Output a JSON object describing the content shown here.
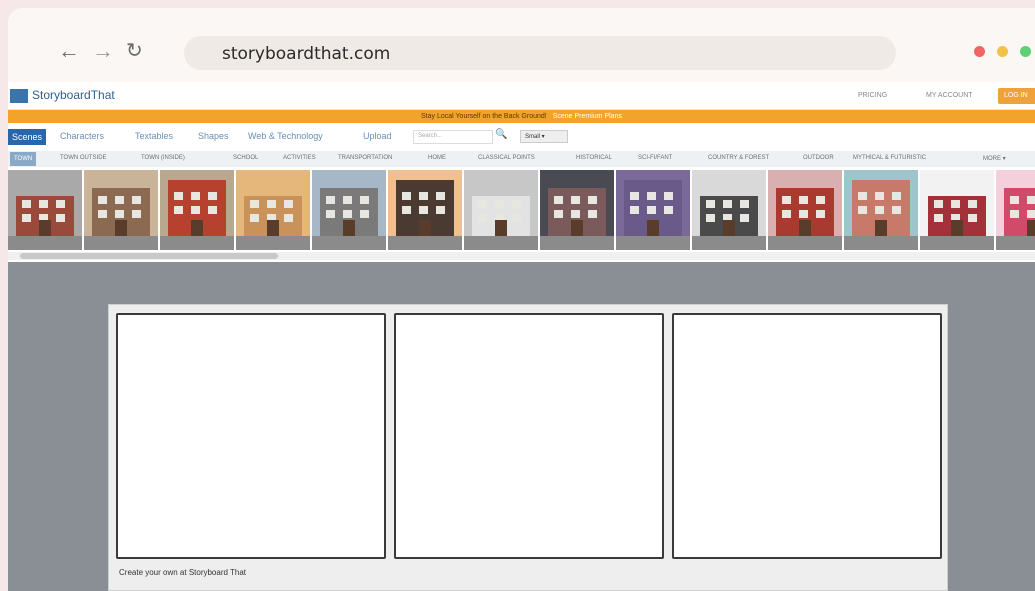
{
  "browser": {
    "url": "storyboardthat.com",
    "back_icon": "←",
    "forward_icon": "→",
    "reload_icon": "↻",
    "dots": [
      "#f06464",
      "#f0c24a",
      "#5fcf74"
    ]
  },
  "header": {
    "logo": "StoryboardThat",
    "pricing": "PRICING",
    "account": "MY ACCOUNT",
    "cta": "LOG IN"
  },
  "promo": {
    "text": "Stay Local Yourself on the Back Ground!",
    "cta": "Scene Premium Plans"
  },
  "tabs": [
    {
      "label": "Scenes",
      "active": true
    },
    {
      "label": "Characters",
      "active": false
    },
    {
      "label": "Textables",
      "active": false
    },
    {
      "label": "Shapes",
      "active": false
    },
    {
      "label": "Web & Technology",
      "active": false
    },
    {
      "label": "Upload",
      "active": false
    }
  ],
  "search": {
    "placeholder": "Search..."
  },
  "view": {
    "label": "Small ▾"
  },
  "categories": [
    {
      "label": "TOWN",
      "active": true
    },
    {
      "label": "TOWN OUTSIDE",
      "active": false
    },
    {
      "label": "TOWN (INSIDE)",
      "active": false
    },
    {
      "label": "SCHOOL",
      "active": false
    },
    {
      "label": "ACTIVITIES",
      "active": false
    },
    {
      "label": "TRANSPORTATION",
      "active": false
    },
    {
      "label": "HOME",
      "active": false
    },
    {
      "label": "CLASSICAL POINTS",
      "active": false
    },
    {
      "label": "HISTORICAL",
      "active": false
    },
    {
      "label": "SCI-FI/FANT",
      "active": false
    },
    {
      "label": "COUNTRY & FOREST",
      "active": false
    },
    {
      "label": "OUTDOOR",
      "active": false
    },
    {
      "label": "MYTHICAL & FUTURISTIC",
      "active": false
    },
    {
      "label": "MORE ▾",
      "active": false
    }
  ],
  "scenes": [
    {
      "name": "scene-1",
      "sky": "#a9a9a9",
      "bldg": "#9a4a3a"
    },
    {
      "name": "scene-2",
      "sky": "#c9b49a",
      "bldg": "#8c6a52"
    },
    {
      "name": "scene-3",
      "sky": "#b8a890",
      "bldg": "#b5412e"
    },
    {
      "name": "scene-4",
      "sky": "#e6b77a",
      "bldg": "#c9925a"
    },
    {
      "name": "scene-5",
      "sky": "#a6b8c8",
      "bldg": "#7a7a7a"
    },
    {
      "name": "scene-6",
      "sky": "#f0c090",
      "bldg": "#4a3a32"
    },
    {
      "name": "scene-7",
      "sky": "#c7c7c7",
      "bldg": "#e3e3e3"
    },
    {
      "name": "scene-8",
      "sky": "#4a4a52",
      "bldg": "#7a5a5a"
    },
    {
      "name": "scene-9",
      "sky": "#7a6a9a",
      "bldg": "#6a5a8a"
    },
    {
      "name": "scene-10",
      "sky": "#d9d9d9",
      "bldg": "#4a4a4a"
    },
    {
      "name": "scene-11",
      "sky": "#d8b0b0",
      "bldg": "#a83a30"
    },
    {
      "name": "scene-12",
      "sky": "#9ec4cc",
      "bldg": "#c87a6a"
    },
    {
      "name": "scene-13",
      "sky": "#f2f2f2",
      "bldg": "#a4303a"
    },
    {
      "name": "scene-14",
      "sky": "#f4d0dc",
      "bldg": "#d04a6a"
    },
    {
      "name": "scene-15",
      "sky": "#7a5a4a",
      "bldg": "#5a4a3a"
    }
  ],
  "storyboard": {
    "caption": "Create your own at Storyboard That"
  }
}
